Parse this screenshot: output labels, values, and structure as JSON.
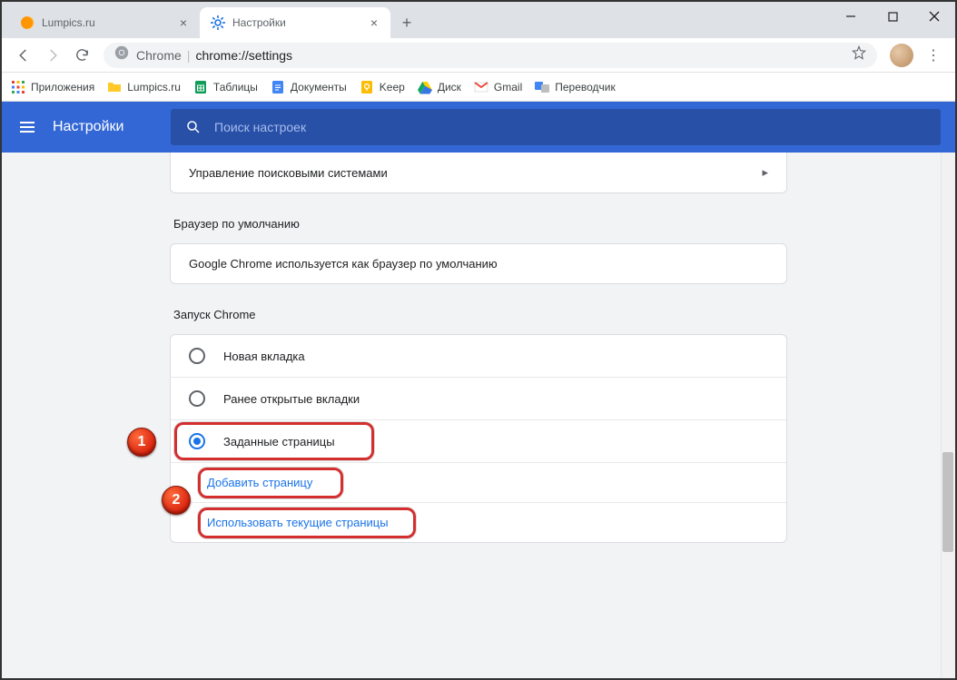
{
  "tabs": [
    {
      "title": "Lumpics.ru",
      "active": false
    },
    {
      "title": "Настройки",
      "active": true
    }
  ],
  "address": {
    "scheme_label": "Chrome",
    "url": "chrome://settings"
  },
  "bookmarks": [
    {
      "label": "Приложения"
    },
    {
      "label": "Lumpics.ru"
    },
    {
      "label": "Таблицы"
    },
    {
      "label": "Документы"
    },
    {
      "label": "Keep"
    },
    {
      "label": "Диск"
    },
    {
      "label": "Gmail"
    },
    {
      "label": "Переводчик"
    }
  ],
  "settings_header": {
    "title": "Настройки",
    "search_placeholder": "Поиск настроек"
  },
  "sections": {
    "search_engines_row": "Управление поисковыми системами",
    "default_browser_title": "Браузер по умолчанию",
    "default_browser_status": "Google Chrome используется как браузер по умолчанию",
    "startup_title": "Запуск Chrome",
    "startup_options": [
      {
        "label": "Новая вкладка",
        "checked": false
      },
      {
        "label": "Ранее открытые вкладки",
        "checked": false
      },
      {
        "label": "Заданные страницы",
        "checked": true
      }
    ],
    "startup_links": {
      "add_page": "Добавить страницу",
      "use_current": "Использовать текущие страницы"
    }
  },
  "annotations": {
    "badge1": "1",
    "badge2": "2"
  }
}
